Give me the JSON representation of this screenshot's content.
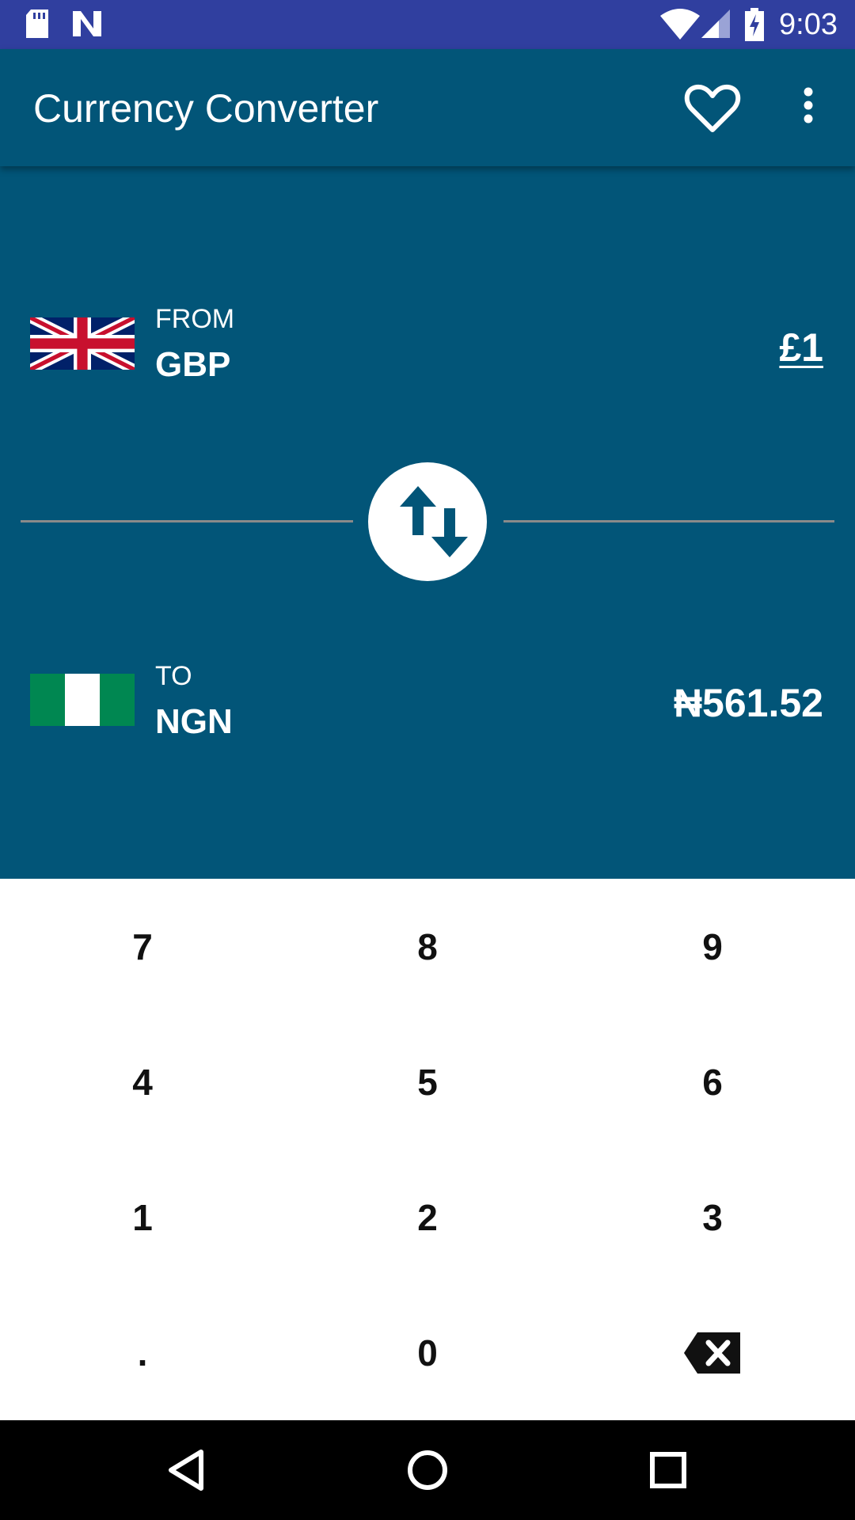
{
  "status_bar": {
    "time": "9:03",
    "left_icons": [
      "sd-card-icon",
      "n-notification-icon"
    ],
    "right_icons": [
      "wifi-icon",
      "signal-icon",
      "battery-charging-icon"
    ]
  },
  "app_bar": {
    "title": "Currency Converter",
    "actions": [
      "heart-icon",
      "more-vert-icon"
    ]
  },
  "from": {
    "label": "FROM",
    "code": "GBP",
    "amount": "£1",
    "flag": "uk-flag"
  },
  "to": {
    "label": "TO",
    "code": "NGN",
    "amount": "₦561.52",
    "flag": "nigeria-flag"
  },
  "swap": {
    "icon": "swap-vertical-icon"
  },
  "keypad": {
    "keys": [
      "7",
      "8",
      "9",
      "4",
      "5",
      "6",
      "1",
      "2",
      "3",
      ".",
      "0"
    ],
    "backspace_icon": "backspace-icon"
  },
  "colors": {
    "status_bar": "#303F9F",
    "primary": "#025578",
    "keypad_bg": "#FFFFFF",
    "nav_bar": "#000000"
  },
  "nav_bar": {
    "buttons": [
      "back-icon",
      "home-icon",
      "recents-icon"
    ]
  }
}
